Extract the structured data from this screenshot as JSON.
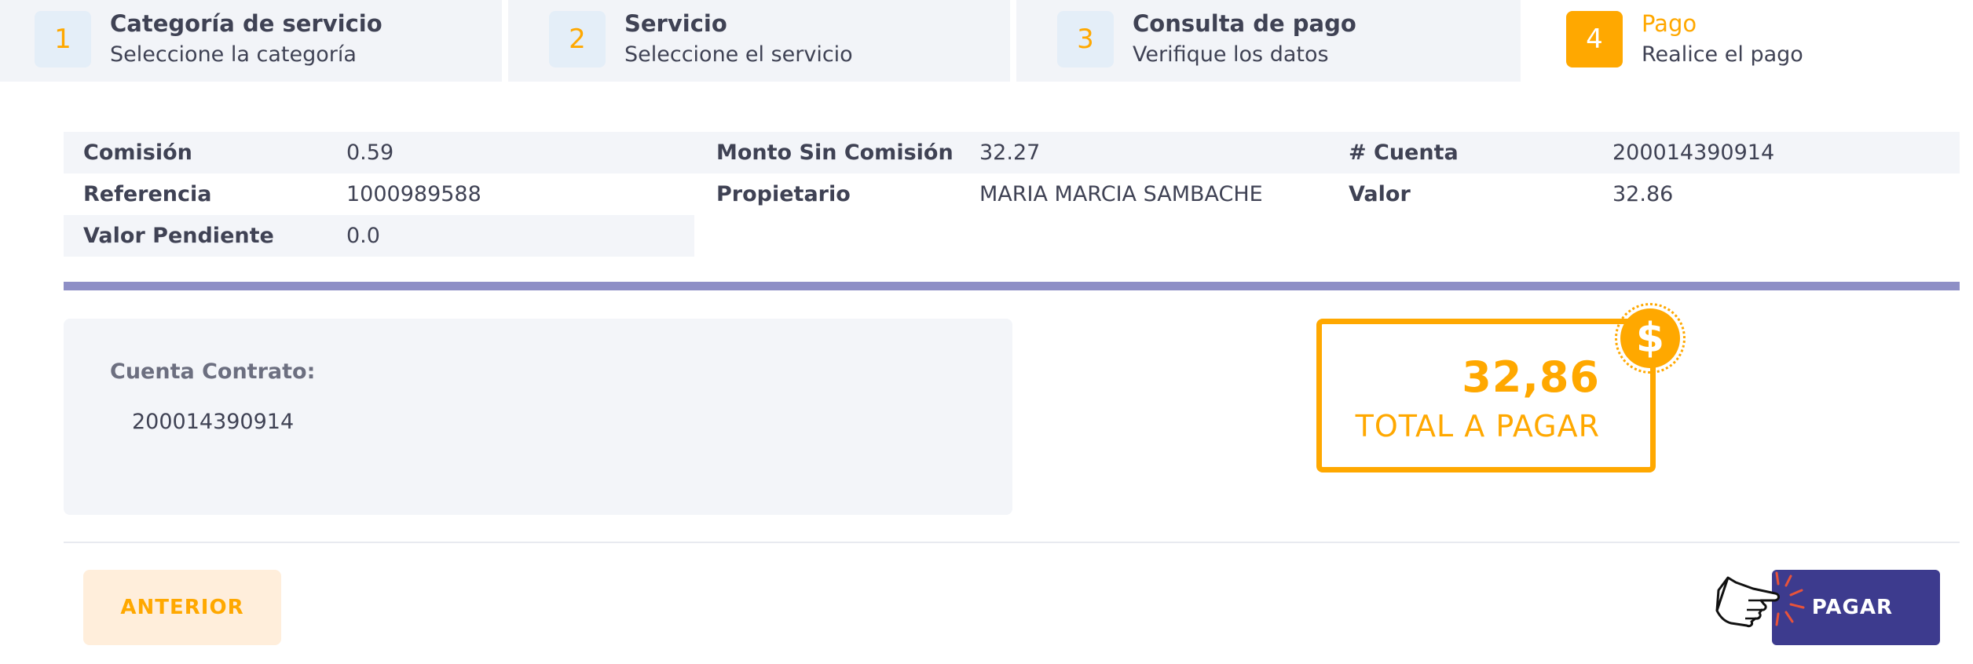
{
  "stepper": {
    "steps": [
      {
        "number": "1",
        "title": "Categoría de servicio",
        "subtitle": "Seleccione la categoría"
      },
      {
        "number": "2",
        "title": "Servicio",
        "subtitle": "Seleccione el servicio"
      },
      {
        "number": "3",
        "title": "Consulta de pago",
        "subtitle": "Verifique los datos"
      },
      {
        "number": "4",
        "title": "Pago",
        "subtitle": "Realice el pago"
      }
    ],
    "active_step": 4
  },
  "details": {
    "comision": {
      "label": "Comisión",
      "value": "0.59"
    },
    "monto_sin_comision": {
      "label": "Monto Sin Comisión",
      "value": "32.27"
    },
    "cuenta": {
      "label": "# Cuenta",
      "value": "200014390914"
    },
    "referencia": {
      "label": "Referencia",
      "value": "1000989588"
    },
    "propietario": {
      "label": "Propietario",
      "value": "MARIA MARCIA SAMBACHE"
    },
    "valor": {
      "label": "Valor",
      "value": "32.86"
    },
    "valor_pendiente": {
      "label": "Valor Pendiente",
      "value": "0.0"
    }
  },
  "contract": {
    "label": "Cuenta Contrato:",
    "value": "200014390914"
  },
  "total": {
    "amount": "32,86",
    "label": "TOTAL A PAGAR",
    "coin_symbol": "$"
  },
  "buttons": {
    "previous_label": "ANTERIOR",
    "pay_label": "PAGAR"
  },
  "colors": {
    "accent": "#ffa800",
    "primary": "#3d3b8e",
    "divider": "#8e8fc6",
    "panel": "#f3f5f9"
  },
  "icons": {
    "coin": "dollar-coin-icon",
    "hand": "pointing-hand-icon"
  }
}
